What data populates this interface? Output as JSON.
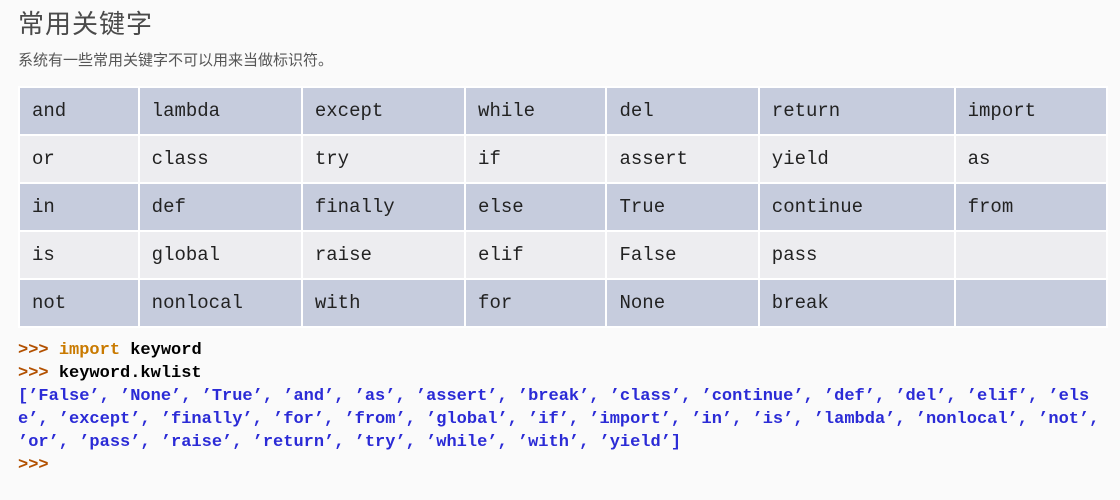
{
  "section": {
    "title": "常用关键字",
    "desc": "系统有一些常用关键字不可以用来当做标识符。"
  },
  "table": {
    "rows": [
      [
        "and",
        "lambda",
        "except",
        "while",
        "del",
        "return",
        "import"
      ],
      [
        "or",
        "class",
        "try",
        "if",
        "assert",
        "yield",
        "as"
      ],
      [
        "in",
        "def",
        "finally",
        "else",
        "True",
        "continue",
        "from"
      ],
      [
        "is",
        "global",
        "raise",
        "elif",
        "False",
        "pass",
        ""
      ],
      [
        "not",
        "nonlocal",
        "with",
        "for",
        "None",
        "break",
        ""
      ]
    ]
  },
  "code": {
    "prompt": ">>>",
    "line1_kw": "import",
    "line1_rest": " keyword",
    "line2": "keyword.kwlist",
    "output": "['False', 'None', 'True', 'and', 'as', 'assert', 'break', 'class', 'continue', 'def', 'del', 'elif', 'else', 'except', 'finally', 'for', 'from', 'global', 'if', 'import', 'in', 'is', 'lambda', 'nonlocal', 'not', 'or', 'pass', 'raise', 'return', 'try', 'while', 'with', 'yield']"
  }
}
